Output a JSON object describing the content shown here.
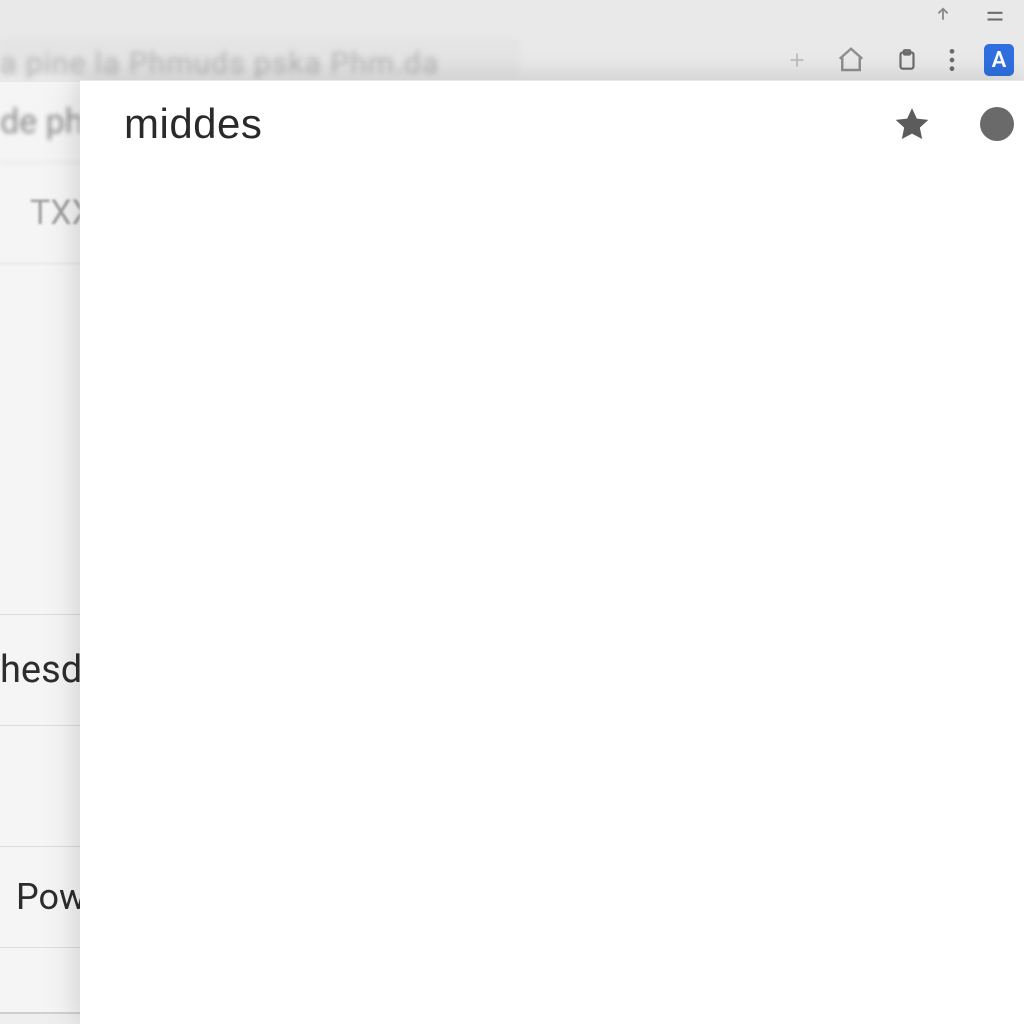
{
  "background": {
    "toolbar": {
      "blur_text": "a  pine la  Phmuds  pska  Phm.da",
      "icons": {
        "share": "share-icon",
        "menu": "menu-icon",
        "clipboard": "clipboard-icon",
        "more": "more-icon",
        "home": "home-icon",
        "add": "add-icon"
      },
      "badge_label": "A"
    },
    "rows": {
      "r1_text": "de phn",
      "r2_text": "TXX",
      "r4_text": "hesd",
      "r6_text": "Powe"
    }
  },
  "foreground": {
    "title_value": "middes",
    "star_icon": "star-icon",
    "status_dot": "profile-dot"
  },
  "colors": {
    "accent_blue": "#2f6fe0",
    "icon_gray": "#6c6c6c",
    "text_dark": "#2a2a2a"
  }
}
